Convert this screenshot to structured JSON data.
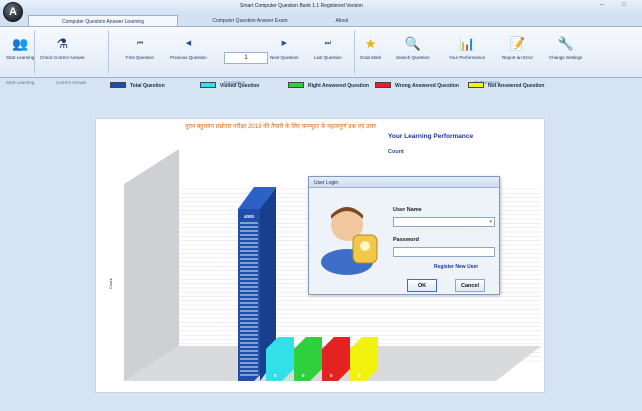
{
  "window": {
    "title": "Smart Computer Question Bank 1.1 Registered Version",
    "app_letter": "A",
    "minimize": "–",
    "maximize": "□"
  },
  "tabs": [
    {
      "label": "Computer Question Answer Learning",
      "active": true
    },
    {
      "label": "Computer Question Answer Exam",
      "active": false
    },
    {
      "label": "About",
      "active": false
    }
  ],
  "ribbon": {
    "start_learning": "Start Learning",
    "check_correct_answer": "Check Correct Answer",
    "first_question": "First Question",
    "previous_question": "Previous Question",
    "page_number": "1",
    "next_question": "Next Question",
    "last_question": "Last Question",
    "grab_mark": "Grab Mark",
    "search_question": "Search Question",
    "your_performance": "Your Performance",
    "report_an_error": "Report an Error",
    "change_settings": "Change Settings",
    "group_start_learning": "Start Learning",
    "group_correct_answer": "Correct Answer",
    "group_navigation": "Navigation",
    "group_performance": "Performance"
  },
  "legend": [
    {
      "label": "Total Question",
      "color": "#1f4ea8"
    },
    {
      "label": "Visited Question",
      "color": "#33e0e8"
    },
    {
      "label": "Right Answered Question",
      "color": "#2ed13b"
    },
    {
      "label": "Wrong Answered Question",
      "color": "#e42222"
    },
    {
      "label": "Not Answered Question",
      "color": "#f3f20f"
    }
  ],
  "chart_header": {
    "hindi_title": "नूतन बहुचयन प्रश्नोत्तर परीक्षा 2013 की तैयारी के लिए कम्प्यूटर के महत्वपूर्ण प्रश्न एवं उत्तर",
    "performance_title": "Your Learning Performance",
    "performance_sub": "Count"
  },
  "chart_data": {
    "type": "bar",
    "categories": [
      "Total Question",
      "Visited Question",
      "Right Answered Question",
      "Wrong Answered Question",
      "Not Answered Question"
    ],
    "values": [
      4000,
      0,
      0,
      0,
      0
    ],
    "bar_labels": [
      "4000",
      "0",
      "0",
      "0",
      "0"
    ],
    "ylabel": "Count",
    "colors": [
      "#1f4ea8",
      "#33e0e8",
      "#2ed13b",
      "#e42222",
      "#f3f20f"
    ]
  },
  "dialog": {
    "title": "User Login",
    "user_name_label": "User Name",
    "user_name_value": "",
    "password_label": "Password",
    "password_value": "",
    "register_link": "Register New User",
    "ok_label": "OK",
    "cancel_label": "Cancel"
  }
}
